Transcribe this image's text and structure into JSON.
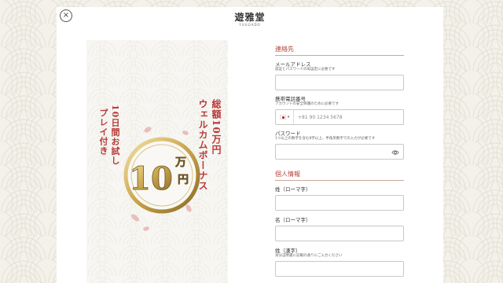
{
  "logo": {
    "name": "遊雅堂",
    "subtitle": "YUUGADO"
  },
  "close_icon": "×",
  "promo": {
    "line1": "総額10万円",
    "line2": "ウェルカムボーナス",
    "line3": "10日間お試し",
    "line4": "プレイ付き",
    "badge_number": "10",
    "badge_unit_top": "万",
    "badge_unit_bottom": "円"
  },
  "form": {
    "contact": {
      "title": "連絡先",
      "email_label": "メールアドレス",
      "email_hint": "認証とパスワードの再設定に必要です",
      "phone_label": "携帯電話番号",
      "phone_hint": "アカウントの安全保護のために必要です",
      "phone_country": "▾",
      "phone_placeholder": "+81 90 1234 5678",
      "password_label": "パスワード",
      "password_hint": "1つ以上の数字を含む8字以上、半角英数字での入力が必要です"
    },
    "personal": {
      "title": "個人情報",
      "last_name_roman_label": "姓（ローマ字）",
      "first_name_roman_label": "名（ローマ字）",
      "last_name_kanji_label": "姓（漢字）",
      "last_name_kanji_hint": "身分証明書に記載の通りにご入力ください"
    }
  },
  "colors": {
    "accent": "#b5453a",
    "gold": "#c9a44c",
    "background": "#f3f1ea"
  }
}
